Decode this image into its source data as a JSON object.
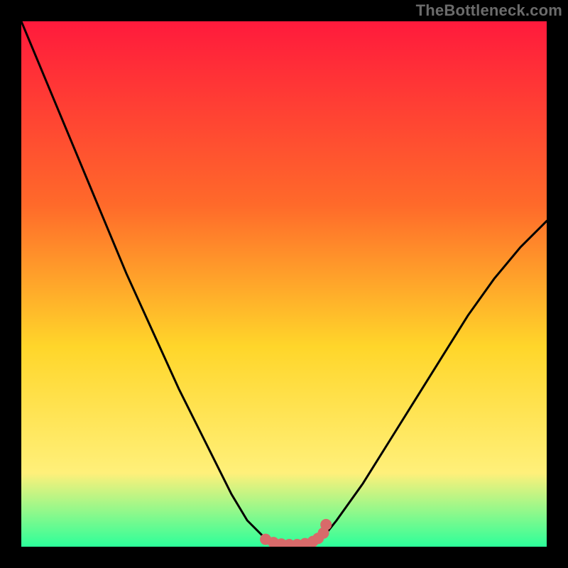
{
  "watermark": "TheBottleneck.com",
  "colors": {
    "frame": "#000000",
    "gradient_top": "#ff1a3c",
    "gradient_mid1": "#ff6a2a",
    "gradient_mid2": "#ffd62a",
    "gradient_mid3": "#fff07a",
    "gradient_bottom": "#2cff9a",
    "curve": "#000000",
    "marker": "#d86a6a"
  },
  "chart_data": {
    "type": "line",
    "title": "",
    "xlabel": "",
    "ylabel": "",
    "xlim": [
      0,
      100
    ],
    "ylim": [
      0,
      100
    ],
    "series": [
      {
        "name": "bottleneck-curve",
        "x": [
          0,
          5,
          10,
          15,
          20,
          25,
          30,
          35,
          40,
          43,
          46,
          48,
          50,
          52,
          54,
          56,
          58,
          60,
          65,
          70,
          75,
          80,
          85,
          90,
          95,
          100
        ],
        "y": [
          100,
          88,
          76,
          64,
          52,
          41,
          30,
          20,
          10,
          5,
          2,
          0.8,
          0.3,
          0.3,
          0.6,
          1.2,
          2.5,
          5,
          12,
          20,
          28,
          36,
          44,
          51,
          57,
          62
        ]
      }
    ],
    "markers": {
      "name": "flat-bottom-markers",
      "x": [
        46.5,
        48,
        49.5,
        51,
        52.5,
        54,
        55.5,
        56.5,
        57.5,
        58
      ],
      "y": [
        1.4,
        0.8,
        0.5,
        0.4,
        0.4,
        0.6,
        1.0,
        1.6,
        2.6,
        4.2
      ]
    },
    "annotations": []
  }
}
